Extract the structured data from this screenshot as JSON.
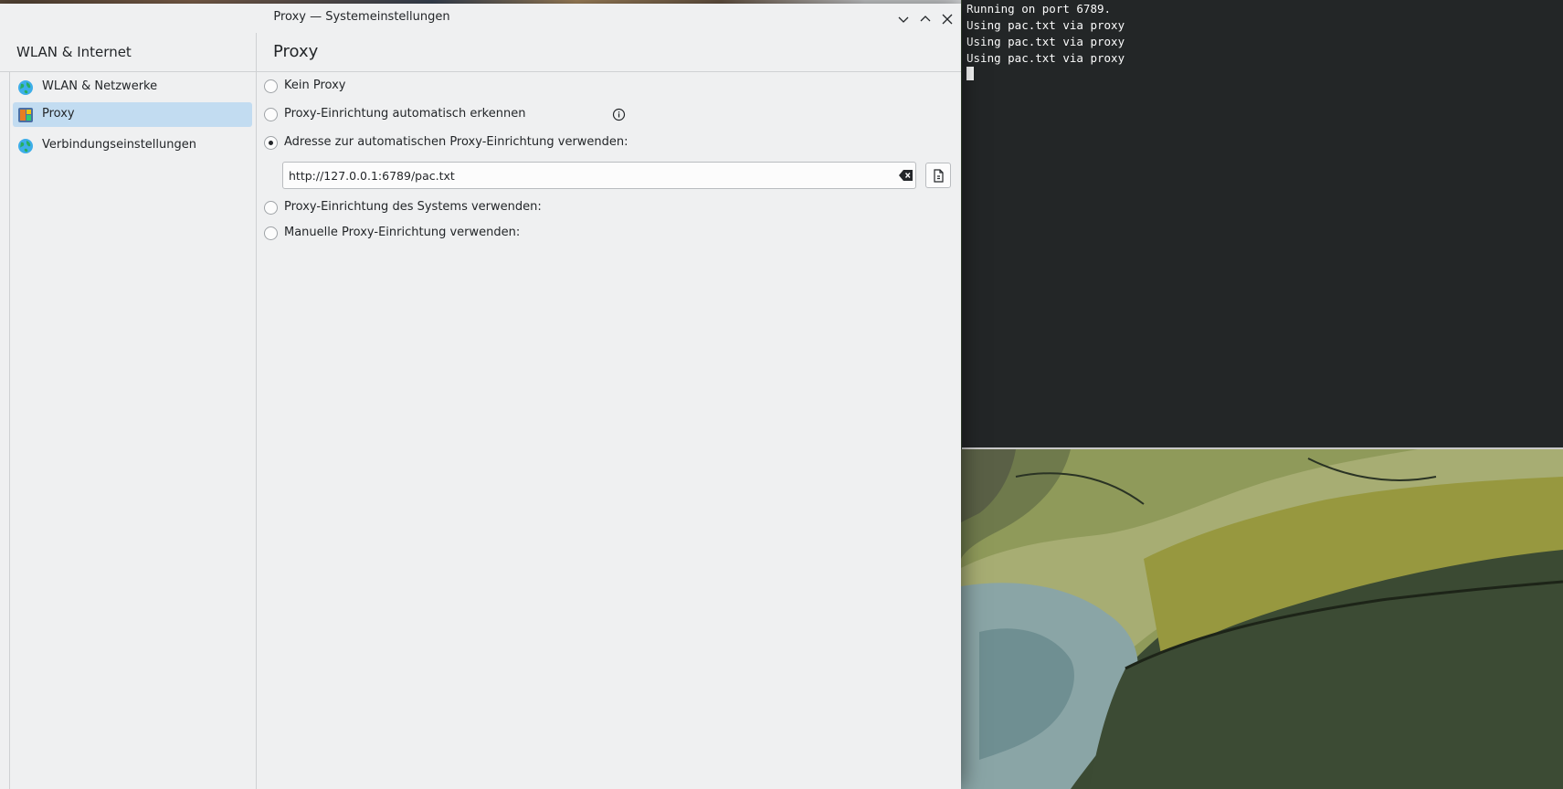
{
  "window": {
    "title": "Proxy — Systemeinstellungen",
    "controls": [
      "minimize",
      "maximize",
      "close"
    ]
  },
  "sidebar": {
    "title": "WLAN & Internet",
    "items": [
      {
        "label": "WLAN & Netzwerke",
        "icon": "globe-network-icon",
        "selected": false
      },
      {
        "label": "Proxy",
        "icon": "proxy-icon",
        "selected": true
      },
      {
        "label": "Verbindungseinstellungen",
        "icon": "globe-settings-icon",
        "selected": false
      }
    ]
  },
  "page": {
    "title": "Proxy",
    "options": [
      {
        "label": "Kein Proxy",
        "checked": false
      },
      {
        "label": "Proxy-Einrichtung automatisch erkennen",
        "checked": false
      },
      {
        "label": "Adresse zur automatischen Proxy-Einrichtung verwenden:",
        "checked": true
      },
      {
        "label": "Proxy-Einrichtung des Systems verwenden:",
        "checked": false
      },
      {
        "label": "Manuelle Proxy-Einrichtung verwenden:",
        "checked": false
      }
    ],
    "pac_url": {
      "value": "http://127.0.0.1:6789/pac.txt"
    },
    "info_icon": "info-icon",
    "clear_icon": "clear-text-icon",
    "open_file_icon": "open-file-icon"
  },
  "terminal": {
    "lines": [
      "Running on port 6789.",
      "Using pac.txt via proxy",
      "Using pac.txt via proxy",
      "Using pac.txt via proxy"
    ]
  },
  "colors": {
    "window_bg": "#eff0f1",
    "selection": "#c2dcf1",
    "terminal_bg": "#232627",
    "terminal_fg": "#fcfcfc"
  }
}
